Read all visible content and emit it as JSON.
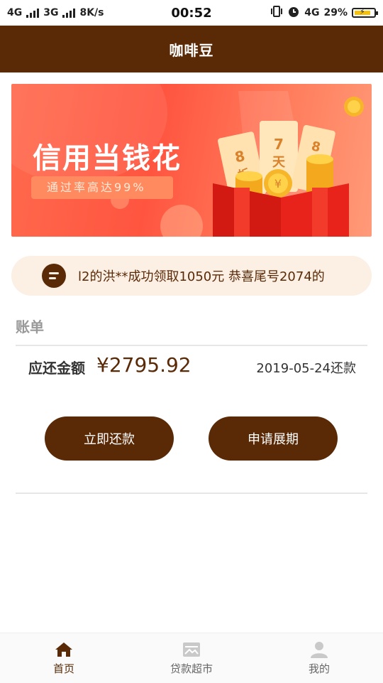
{
  "status_bar": {
    "net1": "4G",
    "net2": "3G",
    "speed": "8K/s",
    "time": "00:52",
    "net3": "4G",
    "battery": "29%"
  },
  "header": {
    "title": "咖啡豆"
  },
  "banner": {
    "headline": "信用当钱花",
    "subline": "通过率高达99%",
    "ticket_texts": [
      "8",
      "折",
      "7",
      "天",
      "8"
    ]
  },
  "notice": {
    "text": "l2的洪**成功领取1050元 恭喜尾号2074的"
  },
  "bill": {
    "section_title": "账单",
    "due_label": "应还金额",
    "due_amount": "¥2795.92",
    "due_date": "2019-05-24还款",
    "repay_button": "立即还款",
    "extend_button": "申请展期"
  },
  "tabbar": {
    "items": [
      {
        "label": "首页",
        "icon": "home-icon",
        "active": true
      },
      {
        "label": "贷款超市",
        "icon": "store-icon",
        "active": false
      },
      {
        "label": "我的",
        "icon": "user-icon",
        "active": false
      }
    ]
  },
  "colors": {
    "brand": "#5a2a07",
    "banner": "#ff5540",
    "notice_bg": "#fcefe4"
  }
}
